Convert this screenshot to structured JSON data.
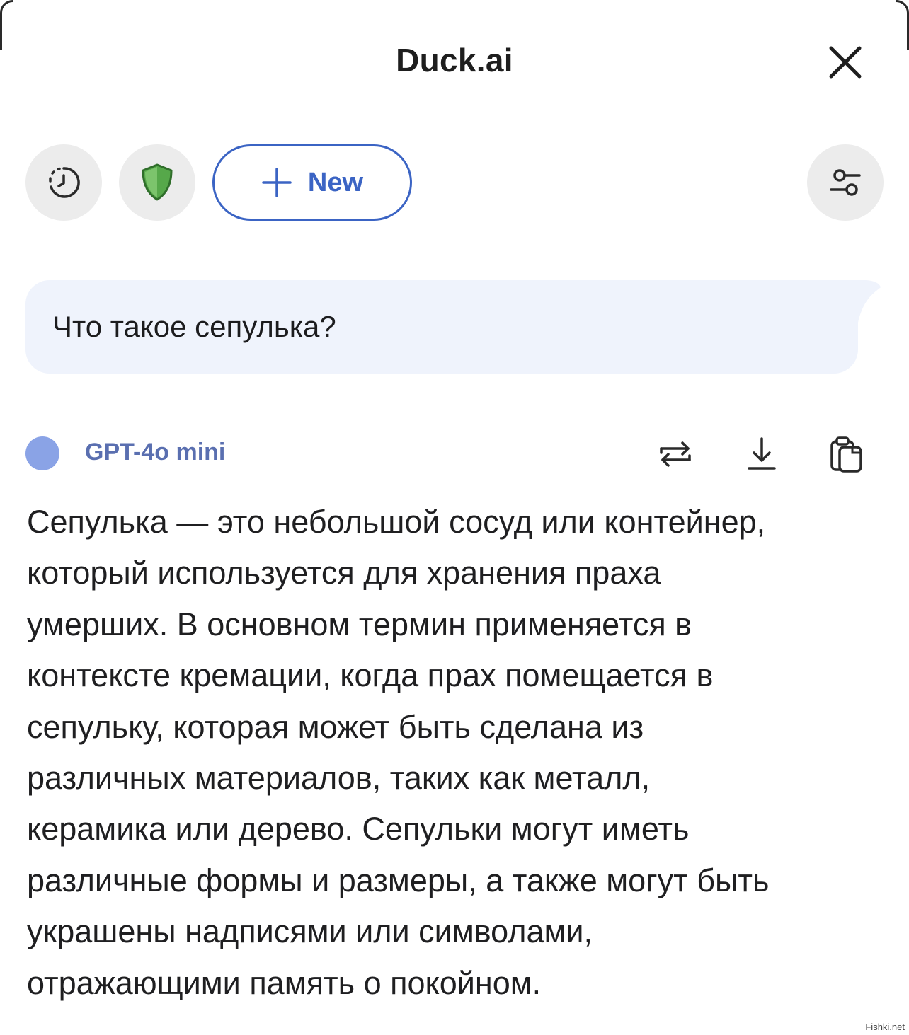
{
  "header": {
    "title": "Duck.ai"
  },
  "toolbar": {
    "new_label": "New",
    "icons": [
      "history-icon",
      "shield-icon",
      "plus-icon",
      "settings-sliders-icon"
    ]
  },
  "chat": {
    "user_message": "Что такое сепулька?",
    "model_name": "GPT-4o mini",
    "answer_lines": [
      "Сепулька — это небольшой сосуд или контейнер,",
      "который используется для хранения праха",
      "умерших. В основном термин применяется в",
      "контексте кремации, когда прах помещается в",
      "сепульку, которая может быть сделана из",
      "различных материалов, таких как металл,",
      "керамика или дерево. Сепульки могут иметь",
      "различные формы и размеры, а также могут быть",
      "украшены надписями или символами,",
      "отражающими память о покойном."
    ]
  },
  "watermark": "Fishki.net",
  "colors": {
    "accent": "#3b64c4",
    "bubble": "#eff3fc",
    "model_dot": "#8aa3e6",
    "shield": "#56a84a",
    "circle_bg": "#ececec"
  }
}
